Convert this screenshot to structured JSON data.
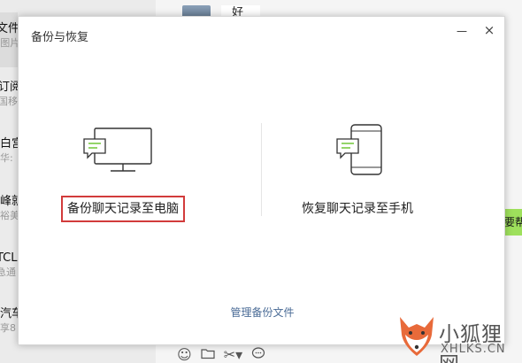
{
  "background": {
    "chat_list": [
      {
        "title": "文件传",
        "snippet": "[图片]"
      },
      {
        "title": "订阅号",
        "snippet": "国移"
      },
      {
        "title": "白宫",
        "snippet": "华:"
      },
      {
        "title": "峰就",
        "snippet": "裕美"
      },
      {
        "title": "TCL智",
        "snippet": "急通"
      },
      {
        "title": "汽车",
        "snippet": "享8"
      }
    ],
    "message_snippet": "好",
    "green_bubble_text": "要帮",
    "toolbar_icons": [
      "emoji-icon",
      "folder-icon",
      "scissors-icon",
      "chat-bubble-icon"
    ]
  },
  "dialog": {
    "title": "备份与恢复",
    "minimize_glyph": "－",
    "close_glyph": "×",
    "options": {
      "backup_label": "备份聊天记录至电脑",
      "restore_label": "恢复聊天记录至手机"
    },
    "manage_link": "管理备份文件"
  },
  "colors": {
    "highlight_border": "#d23b3b",
    "link": "#4a6b96",
    "bubble_green": "#7ac943"
  },
  "watermark": {
    "line1": "小狐狸网",
    "line2": "XHLKS.CN"
  }
}
